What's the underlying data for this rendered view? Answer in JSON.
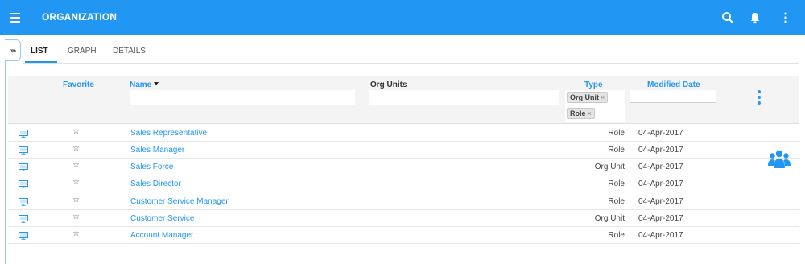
{
  "header": {
    "title": "ORGANIZATION",
    "menu_icon": "hamburger-menu-icon",
    "actions": [
      "search-icon",
      "bell-icon",
      "more-vert-icon"
    ]
  },
  "tabs": [
    {
      "label": "LIST",
      "active": true
    },
    {
      "label": "GRAPH",
      "active": false
    },
    {
      "label": "DETAILS",
      "active": false
    }
  ],
  "sidebar_toggle": "»›",
  "table": {
    "columns": {
      "favorite": "Favorite",
      "name": "Name",
      "org_units": "Org Units",
      "type": "Type",
      "modified_date": "Modified Date"
    },
    "filters": {
      "name": "",
      "org_units": "",
      "modified_date": "",
      "type_chips": [
        "Org Unit",
        "Role"
      ],
      "chip_remove": "×"
    },
    "rows": [
      {
        "name": "Sales Representative",
        "type": "Role",
        "date": "04-Apr-2017"
      },
      {
        "name": "Sales Manager",
        "type": "Role",
        "date": "04-Apr-2017"
      },
      {
        "name": "Sales Force",
        "type": "Org Unit",
        "date": "04-Apr-2017"
      },
      {
        "name": "Sales Director",
        "type": "Role",
        "date": "04-Apr-2017"
      },
      {
        "name": "Customer Service Manager",
        "type": "Role",
        "date": "04-Apr-2017"
      },
      {
        "name": "Customer Service",
        "type": "Org Unit",
        "date": "04-Apr-2017"
      },
      {
        "name": "Account Manager",
        "type": "Role",
        "date": "04-Apr-2017"
      }
    ]
  },
  "colors": {
    "primary": "#2196F3",
    "header_bg": "#f4f4f4",
    "text": "#333333"
  },
  "icons": {
    "row_icon": "monitor-icon",
    "favorite_icon": "star-outline-icon",
    "floating_icon": "group-users-icon"
  }
}
